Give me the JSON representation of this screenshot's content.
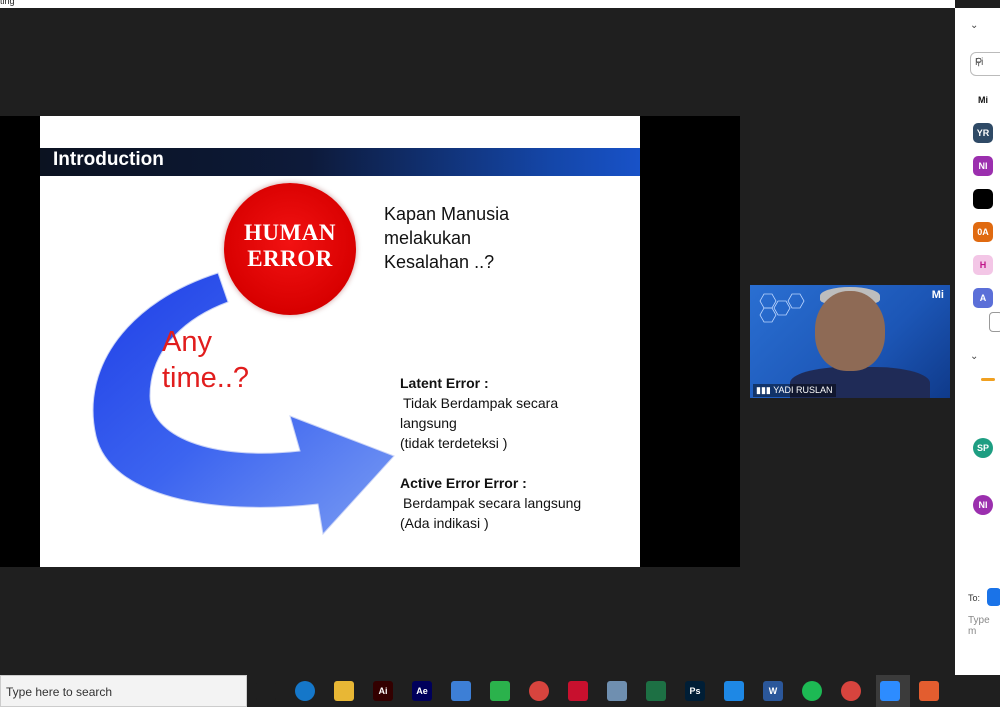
{
  "window": {
    "title_fragment": "ting"
  },
  "slide": {
    "title": "Introduction",
    "human_error": "HUMAN\nERROR",
    "question": "Kapan Manusia\nmelakukan\nKesalahan ..?",
    "any_time": "Any\ntime..?",
    "latent_heading": "Latent Error  :",
    "latent_line1": "Tidak   Berdampak secara",
    "latent_line2": "langsung",
    "latent_line3": "(tidak  terdeteksi )",
    "active_heading": "Active Error Error  :",
    "active_line1": "Berdampak secara langsung",
    "active_line2": "(Ada indikasi )"
  },
  "video": {
    "participant_name": "YADI RUSLAN",
    "logo": "Mi"
  },
  "side_panel": {
    "search_placeholder": "Fi",
    "to_label": "To:",
    "type_placeholder": "Type m",
    "avatars": [
      {
        "initials": "Mi",
        "color": "#ffffff",
        "text_color": "#111111"
      },
      {
        "initials": "YR",
        "color": "#2f4a66",
        "text_color": "#ffffff"
      },
      {
        "initials": "NI",
        "color": "#9b2fae",
        "text_color": "#ffffff"
      },
      {
        "initials": "",
        "color": "#000000",
        "text_color": "#ffffff"
      },
      {
        "initials": "0A",
        "color": "#e06a10",
        "text_color": "#ffffff"
      },
      {
        "initials": "H",
        "color": "#f3c6e6",
        "text_color": "#c0168a"
      },
      {
        "initials": "A",
        "color": "#5b6fd8",
        "text_color": "#ffffff"
      },
      {
        "initials": "SP",
        "color": "#1e9e82",
        "text_color": "#ffffff"
      },
      {
        "initials": "NI",
        "color": "#9b2fae",
        "text_color": "#ffffff"
      }
    ]
  },
  "taskbar": {
    "search_placeholder": "Type here to search",
    "icons": [
      {
        "name": "task-view-icon",
        "label": "",
        "color": "#1f1f1f"
      },
      {
        "name": "edge-icon",
        "label": "",
        "color": "#1577c9"
      },
      {
        "name": "file-explorer-icon",
        "label": "",
        "color": "#e8b735"
      },
      {
        "name": "illustrator-icon",
        "label": "Ai",
        "color": "#330000"
      },
      {
        "name": "after-effects-icon",
        "label": "Ae",
        "color": "#00005b"
      },
      {
        "name": "store-icon",
        "label": "",
        "color": "#3d7fd6"
      },
      {
        "name": "feather-app-icon",
        "label": "",
        "color": "#2bb24c"
      },
      {
        "name": "chrome-icon-1",
        "label": "",
        "color": "#d7443e"
      },
      {
        "name": "acrobat-icon",
        "label": "",
        "color": "#c8102e"
      },
      {
        "name": "scanner-icon",
        "label": "",
        "color": "#6f8fb0"
      },
      {
        "name": "excel-icon",
        "label": "",
        "color": "#1d7044"
      },
      {
        "name": "photoshop-icon",
        "label": "Ps",
        "color": "#001e36"
      },
      {
        "name": "vscode-icon",
        "label": "",
        "color": "#1e88e5"
      },
      {
        "name": "word-icon",
        "label": "W",
        "color": "#2b579a"
      },
      {
        "name": "spotify-icon",
        "label": "",
        "color": "#1db954"
      },
      {
        "name": "chrome-icon-2",
        "label": "",
        "color": "#d7443e"
      },
      {
        "name": "zoom-icon",
        "label": "",
        "color": "#2d8cff"
      },
      {
        "name": "app-icon",
        "label": "",
        "color": "#e35d2f"
      }
    ]
  }
}
